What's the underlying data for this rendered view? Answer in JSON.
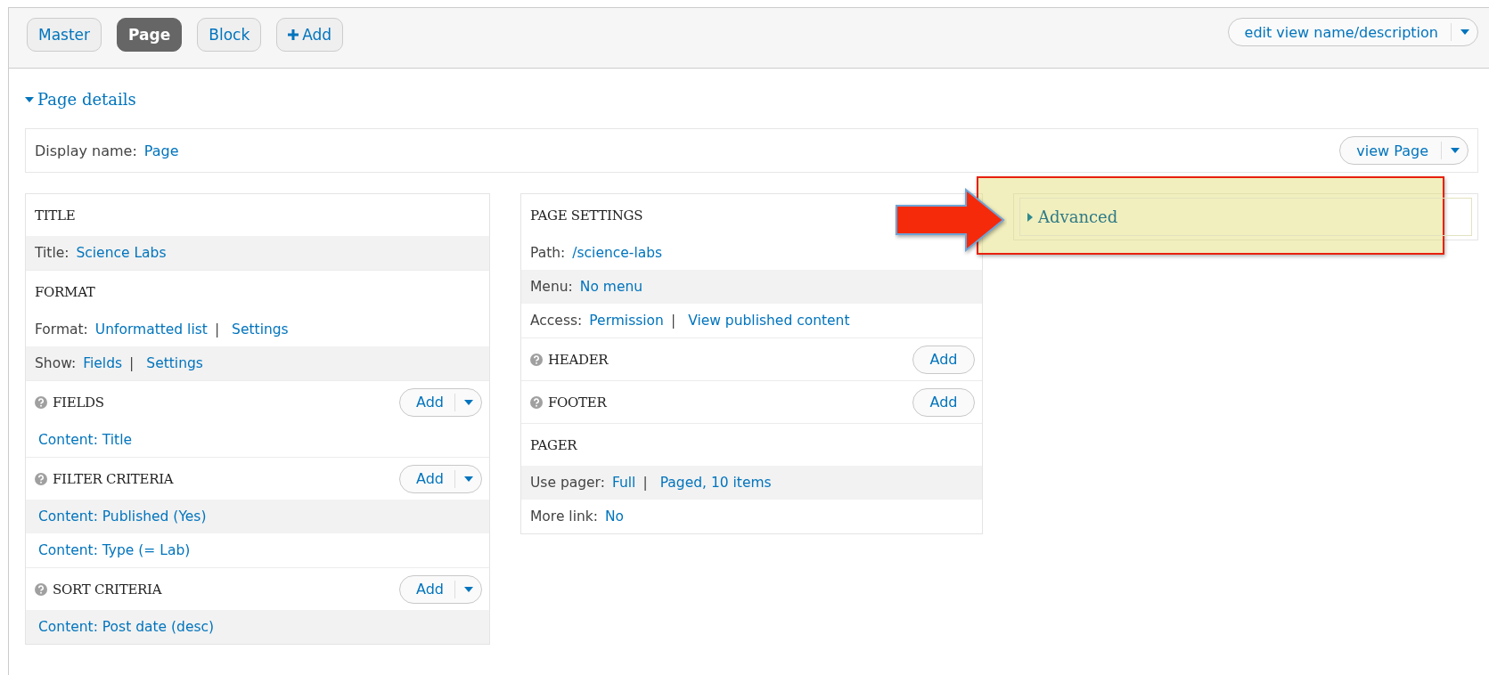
{
  "display_tabs": [
    {
      "label": "Master",
      "selected": false,
      "kind": "tab"
    },
    {
      "label": "Page",
      "selected": true,
      "kind": "tab"
    },
    {
      "label": "Block",
      "selected": false,
      "kind": "tab"
    },
    {
      "label": "Add",
      "selected": false,
      "kind": "add"
    }
  ],
  "edit_menu": {
    "label": "edit view name/description"
  },
  "page_details": {
    "label": "Page details",
    "expanded": true
  },
  "display_name": {
    "label": "Display name:",
    "value": "Page",
    "view_button": "view Page"
  },
  "columns": [
    {
      "sections": [
        {
          "title": "TITLE",
          "help": false,
          "rows": [
            {
              "shaded": true,
              "label": "Title:",
              "parts": [
                {
                  "kind": "link",
                  "text": "Science Labs"
                }
              ]
            }
          ]
        },
        {
          "title": "FORMAT",
          "help": false,
          "rows": [
            {
              "shaded": false,
              "label": "Format:",
              "parts": [
                {
                  "kind": "link",
                  "text": "Unformatted list"
                },
                {
                  "kind": "sep",
                  "text": "|"
                },
                {
                  "kind": "link",
                  "text": "Settings"
                }
              ]
            },
            {
              "shaded": true,
              "label": "Show:",
              "parts": [
                {
                  "kind": "link",
                  "text": "Fields"
                },
                {
                  "kind": "sep",
                  "text": "|"
                },
                {
                  "kind": "link",
                  "text": "Settings"
                }
              ]
            }
          ]
        },
        {
          "title": "FIELDS",
          "help": true,
          "add": {
            "label": "Add",
            "kind": "split"
          },
          "rows": [
            {
              "shaded": false,
              "parts": [
                {
                  "kind": "link",
                  "text": "Content: Title"
                }
              ]
            }
          ]
        },
        {
          "title": "FILTER CRITERIA",
          "help": true,
          "add": {
            "label": "Add",
            "kind": "split"
          },
          "rows": [
            {
              "shaded": true,
              "parts": [
                {
                  "kind": "link",
                  "text": "Content: Published (Yes)"
                }
              ]
            },
            {
              "shaded": false,
              "parts": [
                {
                  "kind": "link",
                  "text": "Content: Type (= Lab)"
                }
              ]
            }
          ]
        },
        {
          "title": "SORT CRITERIA",
          "help": true,
          "add": {
            "label": "Add",
            "kind": "split"
          },
          "rows": [
            {
              "shaded": true,
              "parts": [
                {
                  "kind": "link",
                  "text": "Content: Post date (desc)"
                }
              ]
            }
          ]
        }
      ]
    },
    {
      "sections": [
        {
          "title": "PAGE SETTINGS",
          "help": false,
          "rows": [
            {
              "shaded": false,
              "label": "Path:",
              "parts": [
                {
                  "kind": "link",
                  "text": "/science-labs"
                }
              ]
            },
            {
              "shaded": true,
              "label": "Menu:",
              "parts": [
                {
                  "kind": "link",
                  "text": "No menu"
                }
              ]
            },
            {
              "shaded": false,
              "label": "Access:",
              "parts": [
                {
                  "kind": "link",
                  "text": "Permission"
                },
                {
                  "kind": "sep",
                  "text": "|"
                },
                {
                  "kind": "link",
                  "text": "View published content"
                }
              ]
            }
          ]
        },
        {
          "title": "HEADER",
          "help": true,
          "add": {
            "label": "Add",
            "kind": "plain"
          }
        },
        {
          "title": "FOOTER",
          "help": true,
          "add": {
            "label": "Add",
            "kind": "plain"
          }
        },
        {
          "title": "PAGER",
          "help": false,
          "rows": [
            {
              "shaded": true,
              "label": "Use pager:",
              "parts": [
                {
                  "kind": "link",
                  "text": "Full"
                },
                {
                  "kind": "sep",
                  "text": "|"
                },
                {
                  "kind": "link",
                  "text": "Paged, 10 items"
                }
              ]
            },
            {
              "shaded": false,
              "label": "More link:",
              "parts": [
                {
                  "kind": "link",
                  "text": "No"
                }
              ]
            }
          ]
        }
      ]
    }
  ],
  "advanced": {
    "label": "Advanced",
    "expanded": false,
    "highlighted": true
  }
}
